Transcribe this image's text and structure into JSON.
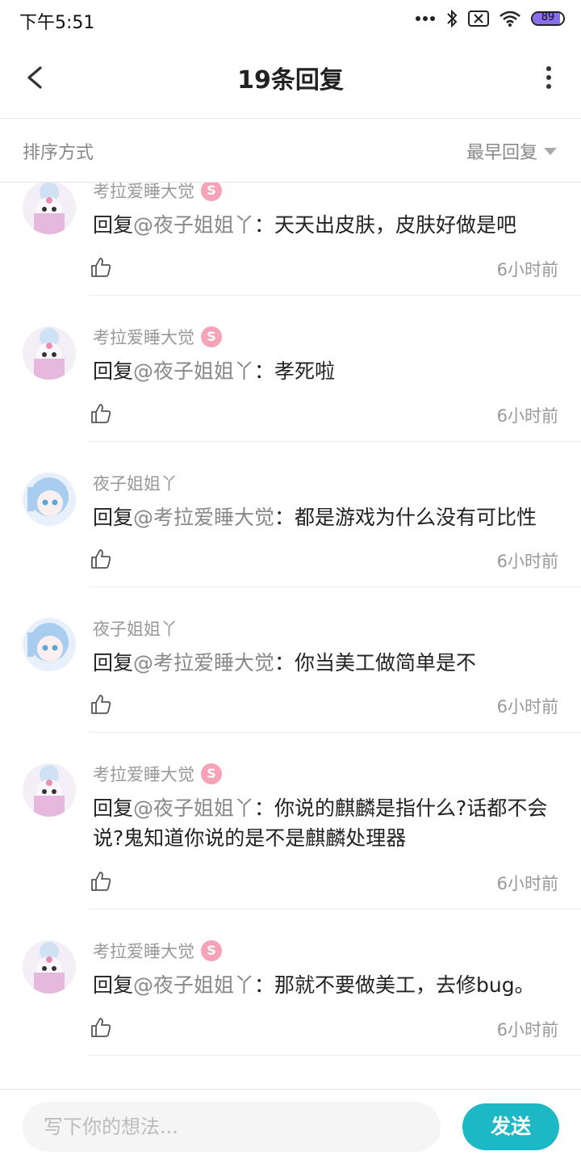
{
  "status_bar": {
    "time": "下午5:51",
    "battery": "89"
  },
  "header": {
    "title": "19条回复"
  },
  "sort": {
    "label": "排序方式",
    "value": "最早回复"
  },
  "replies": [
    {
      "author": "考拉爱睡大觉",
      "badge": "S",
      "reply_prefix": "回复",
      "mention": "@夜子姐姐丫",
      "sep": "：",
      "body": "天天出皮肤，皮肤好做是吧",
      "time": "6小时前"
    },
    {
      "author": "考拉爱睡大觉",
      "badge": "S",
      "reply_prefix": "回复",
      "mention": "@夜子姐姐丫",
      "sep": "：",
      "body": "孝死啦",
      "time": "6小时前"
    },
    {
      "author": "夜子姐姐丫",
      "reply_prefix": "回复",
      "mention": "@考拉爱睡大觉",
      "sep": "：",
      "body": "都是游戏为什么没有可比性",
      "time": "6小时前"
    },
    {
      "author": "夜子姐姐丫",
      "reply_prefix": "回复",
      "mention": "@考拉爱睡大觉",
      "sep": "：",
      "body": "你当美工做简单是不",
      "time": "6小时前"
    },
    {
      "author": "考拉爱睡大觉",
      "badge": "S",
      "reply_prefix": "回复",
      "mention": "@夜子姐姐丫",
      "sep": "：",
      "body": "你说的麒麟是指什么?话都不会说?鬼知道你说的是不是麒麟处理器",
      "time": "6小时前"
    },
    {
      "author": "考拉爱睡大觉",
      "badge": "S",
      "reply_prefix": "回复",
      "mention": "@夜子姐姐丫",
      "sep": "：",
      "body": "那就不要做美工，去修bug。",
      "time": "6小时前"
    }
  ],
  "composer": {
    "placeholder": "写下你的想法...",
    "send_label": "发送"
  },
  "colors": {
    "accent": "#1cb8c6",
    "badge": "#f6a2b7",
    "battery": "#8a6cf0"
  }
}
